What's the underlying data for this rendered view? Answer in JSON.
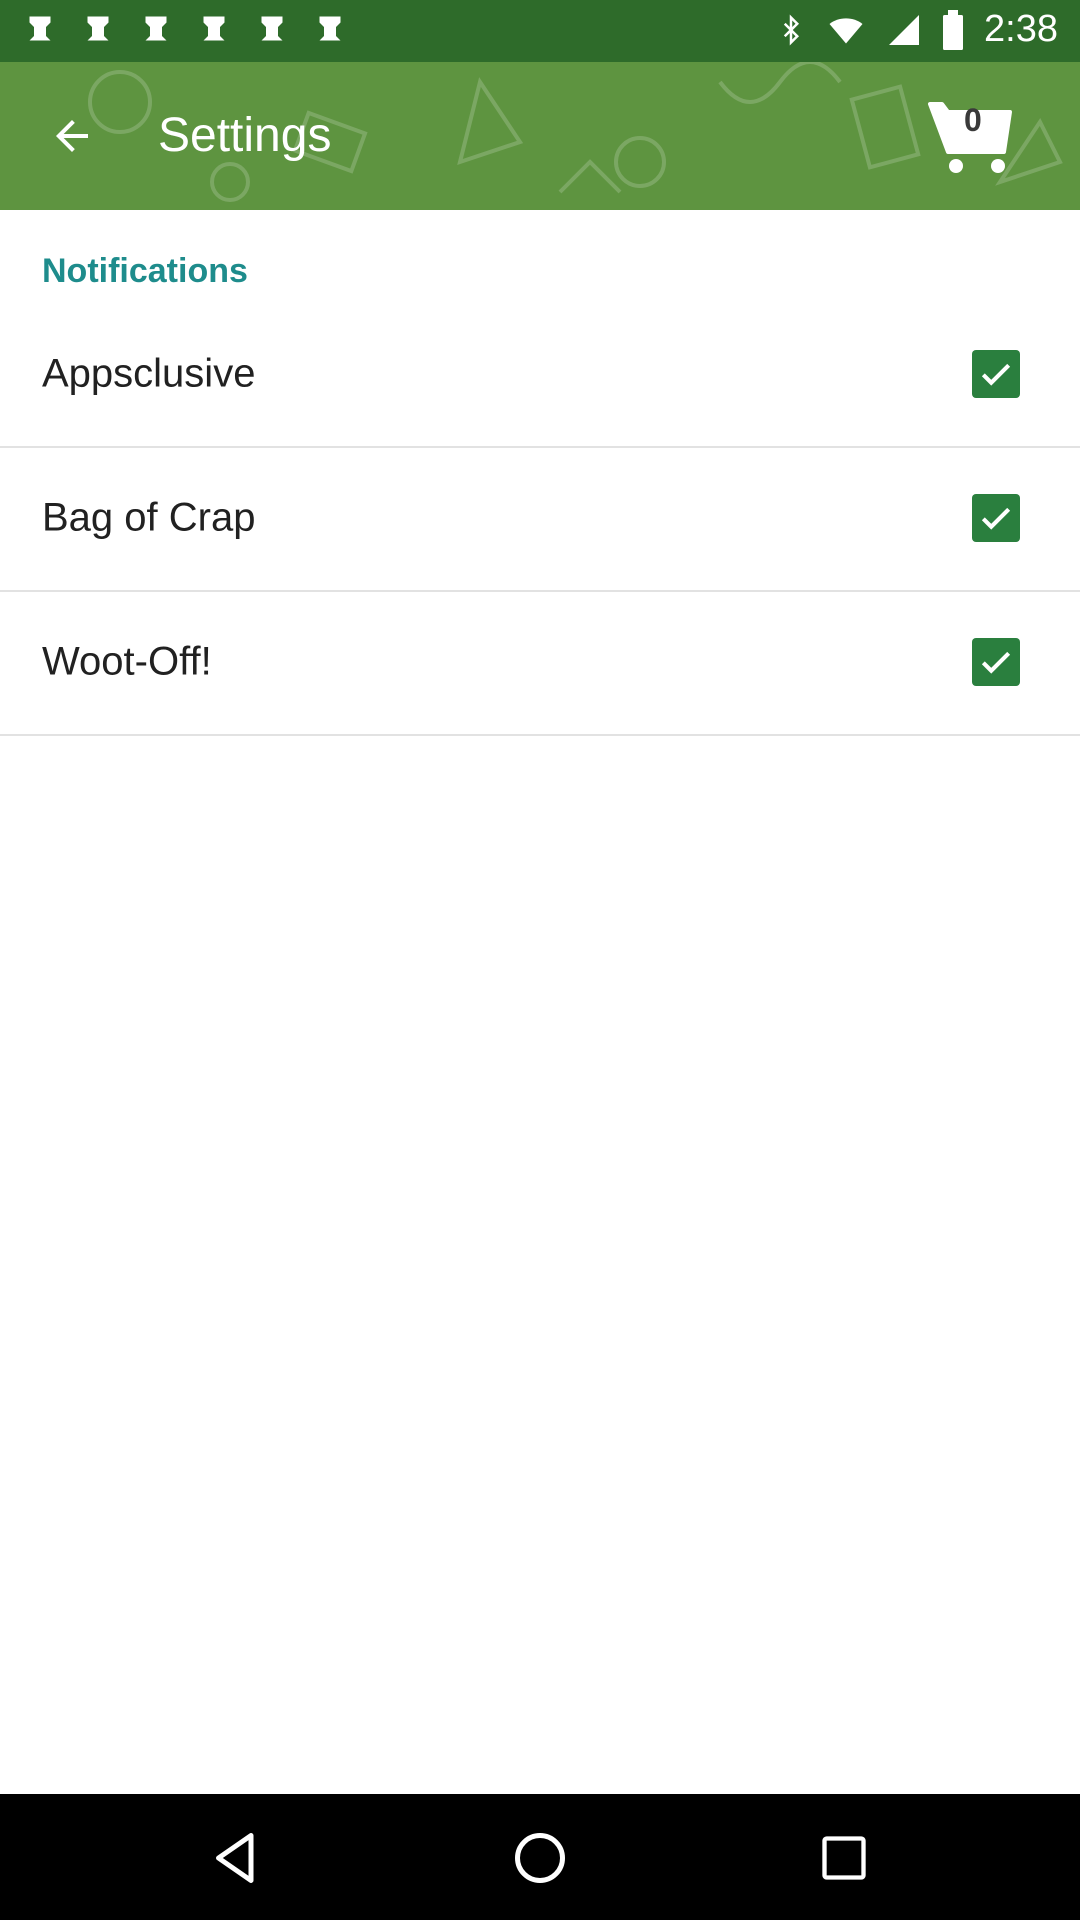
{
  "status_bar": {
    "time": "2:38",
    "left_icons": [
      "notification-icon",
      "notification-icon",
      "notification-icon",
      "notification-icon",
      "notification-icon",
      "notification-icon"
    ],
    "right_icons": [
      "bluetooth-icon",
      "wifi-icon",
      "signal-icon",
      "battery-icon"
    ]
  },
  "app_bar": {
    "title": "Settings",
    "cart_count": "0",
    "back_icon": "arrow-back-icon",
    "cart_icon": "shopping-cart-icon"
  },
  "notifications": {
    "header": "Notifications",
    "items": [
      {
        "label": "Appsclusive",
        "checked": true
      },
      {
        "label": "Bag of Crap",
        "checked": true
      },
      {
        "label": "Woot-Off!",
        "checked": true
      }
    ]
  },
  "nav_bar": {
    "buttons": [
      "nav-back-icon",
      "nav-home-icon",
      "nav-recent-icon"
    ]
  },
  "colors": {
    "status_bar": "#2e6b2a",
    "app_bar": "#5e9440",
    "accent": "#1e8c8c",
    "checkbox": "#2a7f3e"
  }
}
